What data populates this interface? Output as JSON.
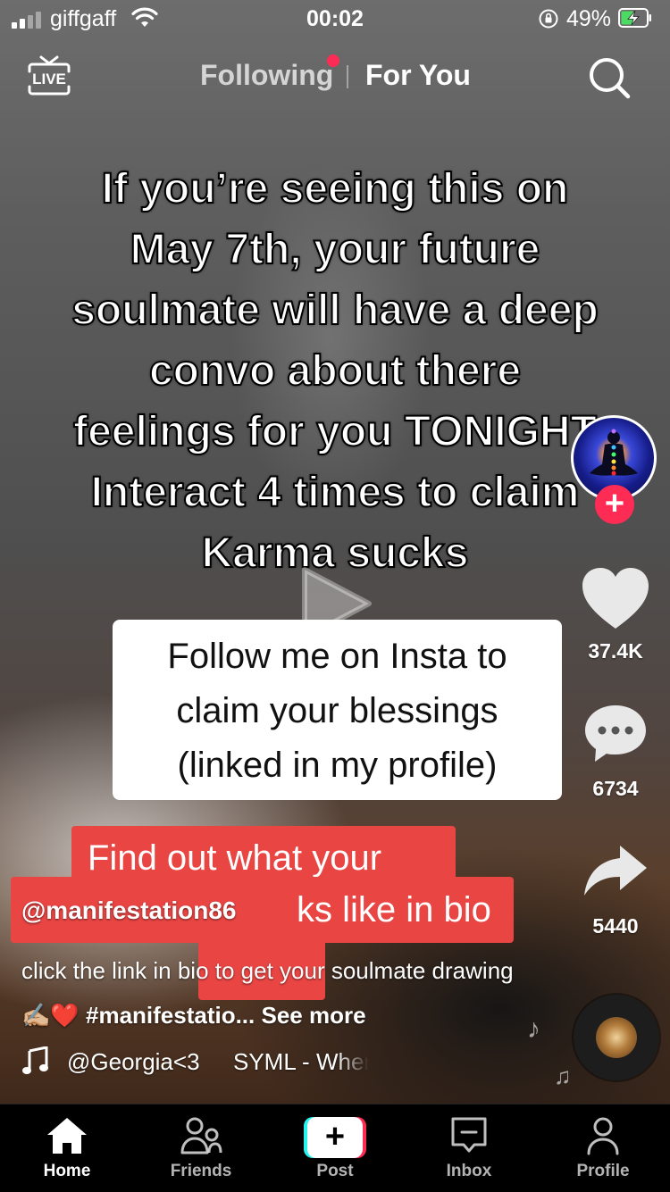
{
  "status_bar": {
    "carrier": "giffgaff",
    "time": "00:02",
    "battery_percent": "49%"
  },
  "top_nav": {
    "live_label": "LIVE",
    "following_label": "Following",
    "for_you_label": "For You"
  },
  "video": {
    "overlay_caption_lines": [
      "If you’re seeing this on",
      "May 7th, your future",
      "soulmate will have a deep",
      "convo about there",
      "feelings for you TONIGHT",
      "Interact 4 times to claim",
      "Karma sucks"
    ],
    "white_box_lines": [
      "Follow me on Insta to",
      "claim your blessings",
      "(linked in my profile)"
    ],
    "red_box_line1": "Find out what your",
    "red_box_line2_tail": "ks like in bio"
  },
  "side_actions": {
    "likes": "37.4K",
    "comments": "6734",
    "shares": "5440"
  },
  "post": {
    "username": "@manifestation86",
    "description_text": "click the link in bio to get your soulmate drawing✍🏼❤️ ",
    "hashtag": "#manifestatio...",
    "see_more": "See more",
    "music_author": "@Georgia<3",
    "music_title": "SYML - Where's My Love"
  },
  "tab_bar": {
    "home": "Home",
    "friends": "Friends",
    "post": "Post",
    "inbox": "Inbox",
    "profile": "Profile"
  },
  "colors": {
    "accent_red": "#fe2c55",
    "accent_cyan": "#25f4ee",
    "caption_box_red": "#e84543"
  }
}
